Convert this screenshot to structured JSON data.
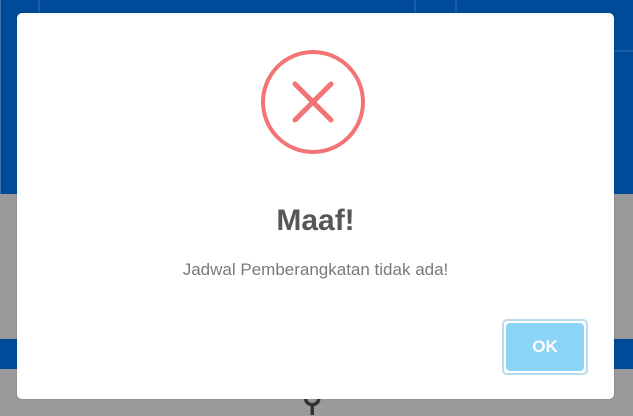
{
  "dialog": {
    "title": "Maaf!",
    "message": "Jadwal Pemberangkatan tidak ada!",
    "icon": "error-x-icon",
    "confirm_label": "OK"
  },
  "colors": {
    "icon_red": "#f27474",
    "button_blue": "#8cd4f5",
    "background_blue": "#004a9a",
    "overlay_gray": "#9a9a9a"
  }
}
